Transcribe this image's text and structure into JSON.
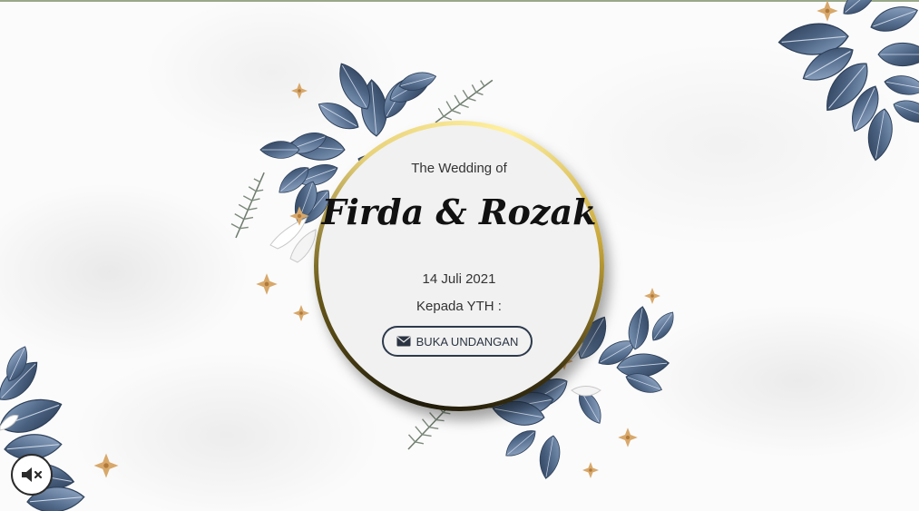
{
  "invitation": {
    "subtitle": "The Wedding of",
    "couple_names": "Firda & Rozak",
    "date": "14 Juli 2021",
    "greeting": "Kepada YTH :",
    "open_button_label": "BUKA UNDANGAN",
    "open_button_icon": "envelope-icon"
  },
  "audio": {
    "toggle_icon": "speaker-muted-icon"
  },
  "theme": {
    "leaf_color": "#4a6180",
    "gold_ring": "#d8c06a",
    "button_border": "#2d3a4c"
  }
}
